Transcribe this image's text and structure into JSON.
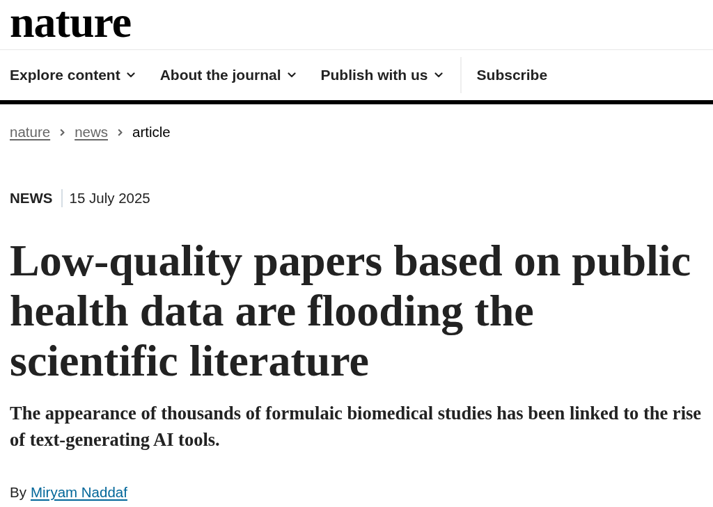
{
  "logo": {
    "text": "nature"
  },
  "nav": {
    "items": [
      {
        "label": "Explore content",
        "kind": "dropdown"
      },
      {
        "label": "About the journal",
        "kind": "dropdown"
      },
      {
        "label": "Publish with us",
        "kind": "dropdown"
      },
      {
        "label": "Subscribe",
        "kind": "link"
      }
    ]
  },
  "breadcrumb": [
    {
      "label": "nature",
      "kind": "link"
    },
    {
      "label": "news",
      "kind": "link"
    },
    {
      "label": "article",
      "kind": "current"
    }
  ],
  "article": {
    "type": "NEWS",
    "date": "15 July 2025",
    "title": "Low-quality papers based on public health data are flooding the scientific literature",
    "standfirst": "The appearance of thousands of formulaic biomedical studies has been linked to the rise of text-generating AI tools.",
    "byline_prefix": "By",
    "author": "Miryam Naddaf"
  }
}
